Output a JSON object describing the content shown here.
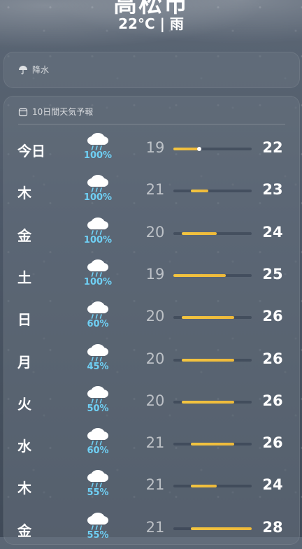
{
  "location": {
    "city": "高松市",
    "current": "22°C | 雨"
  },
  "precip_card": {
    "label": "降水",
    "icon": "umbrella-icon"
  },
  "forecast": {
    "header": "10日間天気予報",
    "icon": "calendar-icon",
    "temp_range": [
      19,
      28
    ],
    "days": [
      {
        "day": "今日",
        "icon": "rain-cloud-icon",
        "chance": "100%",
        "low": "19",
        "high": "22",
        "low_val": 19,
        "high_val": 22,
        "current_temp": 22
      },
      {
        "day": "木",
        "icon": "rain-cloud-icon",
        "chance": "100%",
        "low": "21",
        "high": "23",
        "low_val": 21,
        "high_val": 23
      },
      {
        "day": "金",
        "icon": "rain-cloud-icon",
        "chance": "100%",
        "low": "20",
        "high": "24",
        "low_val": 20,
        "high_val": 24
      },
      {
        "day": "土",
        "icon": "rain-cloud-icon",
        "chance": "100%",
        "low": "19",
        "high": "25",
        "low_val": 19,
        "high_val": 25
      },
      {
        "day": "日",
        "icon": "rain-cloud-icon",
        "chance": "60%",
        "low": "20",
        "high": "26",
        "low_val": 20,
        "high_val": 26
      },
      {
        "day": "月",
        "icon": "rain-cloud-icon",
        "chance": "45%",
        "low": "20",
        "high": "26",
        "low_val": 20,
        "high_val": 26
      },
      {
        "day": "火",
        "icon": "rain-cloud-icon",
        "chance": "50%",
        "low": "20",
        "high": "26",
        "low_val": 20,
        "high_val": 26
      },
      {
        "day": "水",
        "icon": "rain-cloud-icon",
        "chance": "60%",
        "low": "21",
        "high": "26",
        "low_val": 21,
        "high_val": 26
      },
      {
        "day": "木",
        "icon": "rain-cloud-icon",
        "chance": "55%",
        "low": "21",
        "high": "24",
        "low_val": 21,
        "high_val": 24
      },
      {
        "day": "金",
        "icon": "rain-cloud-icon",
        "chance": "55%",
        "low": "21",
        "high": "28",
        "low_val": 21,
        "high_val": 28
      }
    ]
  },
  "colors": {
    "bar": "#f3c540",
    "chance": "#6fd0f5"
  }
}
